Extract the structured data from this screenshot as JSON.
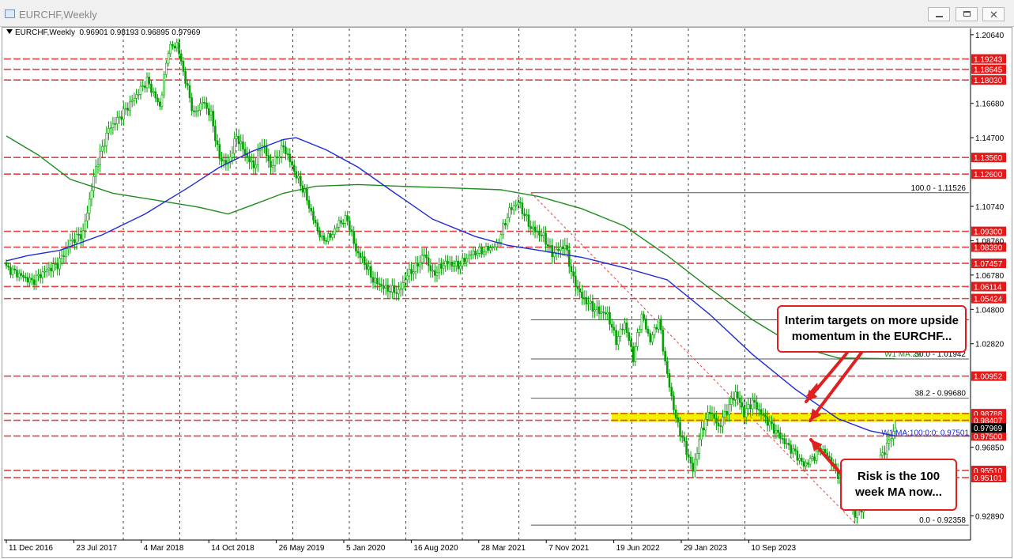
{
  "window": {
    "title": "EURCHF,Weekly"
  },
  "chart_header": "EURCHF,Weekly  0.96901 0.98193 0.96895 0.97969",
  "colors": {
    "candle": "#00a000",
    "ma100": "#1f2bd6",
    "ma200": "#1e8c1e",
    "level": "#e84040",
    "highlight": "#f5f000",
    "fib": "#555555",
    "annotation": "#e02020"
  },
  "chart_data": {
    "type": "candlestick",
    "symbol": "EURCHF",
    "timeframe": "Weekly",
    "header_ohlc": {
      "open": 0.96901,
      "high": 0.98193,
      "low": 0.96895,
      "close": 0.97969
    },
    "ylim": [
      0.915,
      1.21
    ],
    "x_tick_labels": [
      "11 Dec 2016",
      "23 Jul 2017",
      "4 Mar 2018",
      "14 Oct 2018",
      "26 May 2019",
      "5 Jan 2020",
      "16 Aug 2020",
      "28 Mar 2021",
      "7 Nov 2021",
      "19 Jun 2022",
      "29 Jan 2023",
      "10 Sep 2023"
    ],
    "y_tick_labels": [
      "1.20640",
      "1.16680",
      "1.14700",
      "1.10740",
      "1.08760",
      "1.06780",
      "1.04800",
      "1.02820",
      "0.96850",
      "0.92890"
    ],
    "price_path": [
      [
        0,
        1.072
      ],
      [
        6,
        1.068
      ],
      [
        12,
        1.064
      ],
      [
        18,
        1.07
      ],
      [
        24,
        1.074
      ],
      [
        27,
        1.08
      ],
      [
        30,
        1.087
      ],
      [
        36,
        1.092
      ],
      [
        42,
        1.13
      ],
      [
        48,
        1.152
      ],
      [
        54,
        1.16
      ],
      [
        60,
        1.17
      ],
      [
        66,
        1.18
      ],
      [
        72,
        1.165
      ],
      [
        76,
        1.198
      ],
      [
        80,
        1.201
      ],
      [
        84,
        1.18
      ],
      [
        88,
        1.16
      ],
      [
        92,
        1.168
      ],
      [
        96,
        1.16
      ],
      [
        100,
        1.135
      ],
      [
        104,
        1.132
      ],
      [
        108,
        1.148
      ],
      [
        112,
        1.138
      ],
      [
        116,
        1.13
      ],
      [
        120,
        1.144
      ],
      [
        124,
        1.13
      ],
      [
        130,
        1.142
      ],
      [
        136,
        1.125
      ],
      [
        140,
        1.115
      ],
      [
        144,
        1.1
      ],
      [
        148,
        1.088
      ],
      [
        152,
        1.09
      ],
      [
        156,
        1.098
      ],
      [
        160,
        1.1
      ],
      [
        164,
        1.082
      ],
      [
        168,
        1.075
      ],
      [
        172,
        1.065
      ],
      [
        178,
        1.06
      ],
      [
        184,
        1.058
      ],
      [
        188,
        1.068
      ],
      [
        192,
        1.072
      ],
      [
        196,
        1.08
      ],
      [
        200,
        1.068
      ],
      [
        206,
        1.075
      ],
      [
        212,
        1.073
      ],
      [
        218,
        1.08
      ],
      [
        224,
        1.082
      ],
      [
        230,
        1.085
      ],
      [
        236,
        1.105
      ],
      [
        240,
        1.11
      ],
      [
        246,
        1.095
      ],
      [
        252,
        1.09
      ],
      [
        256,
        1.08
      ],
      [
        262,
        1.085
      ],
      [
        266,
        1.065
      ],
      [
        270,
        1.055
      ],
      [
        276,
        1.048
      ],
      [
        282,
        1.045
      ],
      [
        286,
        1.03
      ],
      [
        290,
        1.04
      ],
      [
        294,
        1.02
      ],
      [
        298,
        1.045
      ],
      [
        302,
        1.03
      ],
      [
        306,
        1.042
      ],
      [
        310,
        1.01
      ],
      [
        314,
        0.985
      ],
      [
        318,
        0.97
      ],
      [
        322,
        0.955
      ],
      [
        326,
        0.978
      ],
      [
        330,
        0.99
      ],
      [
        334,
        0.98
      ],
      [
        338,
        0.99
      ],
      [
        342,
        1.0
      ],
      [
        346,
        0.988
      ],
      [
        350,
        0.995
      ],
      [
        354,
        0.988
      ],
      [
        358,
        0.982
      ],
      [
        362,
        0.976
      ],
      [
        366,
        0.97
      ],
      [
        370,
        0.965
      ],
      [
        374,
        0.958
      ],
      [
        378,
        0.962
      ],
      [
        382,
        0.968
      ],
      [
        386,
        0.962
      ],
      [
        390,
        0.953
      ],
      [
        394,
        0.94
      ],
      [
        398,
        0.93
      ],
      [
        402,
        0.935
      ],
      [
        406,
        0.948
      ],
      [
        410,
        0.962
      ],
      [
        414,
        0.972
      ],
      [
        417,
        0.9797
      ]
    ],
    "series": [
      {
        "name": "W1 MA:100:0:0: 0.97501"
      },
      {
        "name": "W1 MA:200:0:0"
      }
    ],
    "ma100_path": [
      [
        0,
        1.076
      ],
      [
        10,
        1.079
      ],
      [
        25,
        1.082
      ],
      [
        45,
        1.091
      ],
      [
        65,
        1.103
      ],
      [
        85,
        1.118
      ],
      [
        100,
        1.13
      ],
      [
        115,
        1.139
      ],
      [
        130,
        1.146
      ],
      [
        136,
        1.147
      ],
      [
        150,
        1.14
      ],
      [
        165,
        1.13
      ],
      [
        180,
        1.117
      ],
      [
        200,
        1.1
      ],
      [
        220,
        1.09
      ],
      [
        235,
        1.085
      ],
      [
        250,
        1.082
      ],
      [
        270,
        1.078
      ],
      [
        290,
        1.072
      ],
      [
        310,
        1.065
      ],
      [
        330,
        1.045
      ],
      [
        350,
        1.022
      ],
      [
        370,
        1.002
      ],
      [
        390,
        0.985
      ],
      [
        405,
        0.978
      ],
      [
        417,
        0.975
      ]
    ],
    "ma200_path": [
      [
        0,
        1.148
      ],
      [
        15,
        1.137
      ],
      [
        30,
        1.123
      ],
      [
        50,
        1.115
      ],
      [
        70,
        1.111
      ],
      [
        90,
        1.107
      ],
      [
        104,
        1.103
      ],
      [
        115,
        1.108
      ],
      [
        130,
        1.115
      ],
      [
        145,
        1.119
      ],
      [
        165,
        1.12
      ],
      [
        185,
        1.119
      ],
      [
        210,
        1.118
      ],
      [
        232,
        1.117
      ],
      [
        250,
        1.113
      ],
      [
        270,
        1.106
      ],
      [
        290,
        1.096
      ],
      [
        310,
        1.079
      ],
      [
        330,
        1.06
      ],
      [
        350,
        1.042
      ],
      [
        370,
        1.027
      ],
      [
        390,
        1.02
      ],
      [
        417,
        1.0195
      ]
    ],
    "horizontal_levels": [
      {
        "value": 1.19243,
        "label": "1.19243"
      },
      {
        "value": 1.18645,
        "label": "1.18645"
      },
      {
        "value": 1.1803,
        "label": "1.18030"
      },
      {
        "value": 1.1356,
        "label": "1.13560"
      },
      {
        "value": 1.126,
        "label": "1.12600"
      },
      {
        "value": 1.093,
        "label": "1.09300"
      },
      {
        "value": 1.0839,
        "label": "1.08390"
      },
      {
        "value": 1.07457,
        "label": "1.07457"
      },
      {
        "value": 1.06114,
        "label": "1.06114"
      },
      {
        "value": 1.05424,
        "label": "1.05424"
      },
      {
        "value": 1.00952,
        "label": "1.00952"
      },
      {
        "value": 0.98788,
        "label": "0.98788"
      },
      {
        "value": 0.98407,
        "label": "0.98407"
      },
      {
        "value": 0.975,
        "label": "0.97500"
      },
      {
        "value": 0.9551,
        "label": "0.95510"
      },
      {
        "value": 0.95101,
        "label": "0.95101"
      }
    ],
    "current_price": {
      "value": 0.97969,
      "label": "0.97969"
    },
    "highlight_zone": [
      0.98407,
      0.98788
    ],
    "fib_levels": [
      {
        "value": 1.11526,
        "label": "100.0 - 1.11526"
      },
      {
        "value": 1.01942,
        "label": "50.0 - 1.01942"
      },
      {
        "value": 0.9968,
        "label": "38.2 - 0.99680"
      },
      {
        "value": 0.92358,
        "label": "0.0 - 0.92358"
      }
    ],
    "fib_extra_level": 1.042,
    "fib_start_index": 246,
    "ma100_label": "W1 MA:100:0:0: 0.97501",
    "ma200_label_partial": "W1 MA:20"
  },
  "annotations": {
    "targets": "Interim targets on more upside momentum in the EURCHF...",
    "risk": "Risk is the 100 week MA now..."
  }
}
